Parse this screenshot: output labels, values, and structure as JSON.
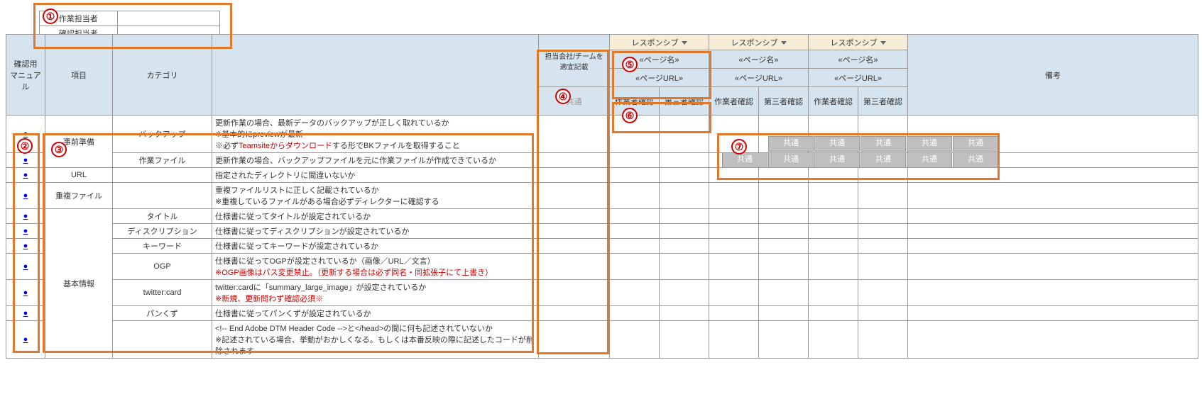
{
  "top_table": {
    "row1_label": "作業担当者",
    "row2_label": "確認担当者"
  },
  "main_header": {
    "col_manual": "確認用\nマニュアル",
    "col_item": "項目",
    "col_category": "カテゴリ",
    "col_team": "担当会社/チームを適宜記載",
    "col_common_hidden": "共通",
    "responsive_label": "レスポンシブ",
    "page_name": "«ページ名»",
    "page_url": "«ページURL»",
    "worker_check": "作業者確認",
    "third_check": "第三者確認",
    "remarks": "備考"
  },
  "rows": [
    {
      "link": "●",
      "item": "事前準備",
      "category": "バックアップ",
      "desc_lines": [
        {
          "text": "更新作業の場合、最新データのバックアップが正しく取れているか",
          "red": false
        },
        {
          "text": "※基本的にpreviewが最新",
          "red": false
        },
        {
          "text": "※必ずTeamsiteからダウンロードする形でBKファイルを取得すること",
          "red": false,
          "mixed_red": "Teamsiteからダウンロード"
        }
      ]
    },
    {
      "link": "●",
      "item": "",
      "category": "作業ファイル",
      "desc_lines": [
        {
          "text": "更新作業の場合、バックアップファイルを元に作業ファイルが作成できているか",
          "red": false
        }
      ]
    },
    {
      "link": "●",
      "item": "URL",
      "category": "",
      "desc_lines": [
        {
          "text": "指定されたディレクトリに間違いないか",
          "red": false
        }
      ]
    },
    {
      "link": "●",
      "item": "重複ファイル",
      "category": "",
      "desc_lines": [
        {
          "text": "重複ファイルリストに正しく記載されているか",
          "red": false
        },
        {
          "text": "※重複しているファイルがある場合必ずディレクターに確認する",
          "red": false
        }
      ]
    },
    {
      "link": "●",
      "item": "基本情報",
      "category": "タイトル",
      "desc_lines": [
        {
          "text": "仕様書に従ってタイトルが設定されているか",
          "red": false
        }
      ]
    },
    {
      "link": "●",
      "item": "",
      "category": "ディスクリプション",
      "desc_lines": [
        {
          "text": "仕様書に従ってディスクリプションが設定されているか",
          "red": false
        }
      ]
    },
    {
      "link": "●",
      "item": "",
      "category": "キーワード",
      "desc_lines": [
        {
          "text": "仕様書に従ってキーワードが設定されているか",
          "red": false
        }
      ]
    },
    {
      "link": "●",
      "item": "",
      "category": "OGP",
      "desc_lines": [
        {
          "text": "仕様書に従ってOGPが設定されているか（画像／URL／文言）",
          "red": false
        },
        {
          "text": "※OGP画像はパス変更禁止。（更新する場合は必ず同名・同拡張子にて上書き）",
          "red": true
        }
      ]
    },
    {
      "link": "●",
      "item": "",
      "category": "twitter:card",
      "desc_lines": [
        {
          "text": "twitter:cardに「summary_large_image」が設定されているか",
          "red": false
        },
        {
          "text": "※新規、更新問わず確認必須※",
          "red": true
        }
      ]
    },
    {
      "link": "●",
      "item": "",
      "category": "パンくず",
      "desc_lines": [
        {
          "text": "仕様書に従ってパンくずが設定されているか",
          "red": false
        }
      ]
    },
    {
      "link": "●",
      "item": "",
      "category": "",
      "desc_lines": [
        {
          "text": "<!-- End Adobe DTM Header Code -->と</head>の間に何も記述されていないか",
          "red": false
        },
        {
          "text": "※記述されている場合、挙動がおかしくなる。もしくは本番反映の際に記述したコードが削除されます",
          "red": false
        }
      ]
    }
  ],
  "grey_button_label": "共通",
  "annotations": {
    "1": "①",
    "2": "②",
    "3": "③",
    "4": "④",
    "5": "⑤",
    "6": "⑥",
    "7": "⑦"
  }
}
